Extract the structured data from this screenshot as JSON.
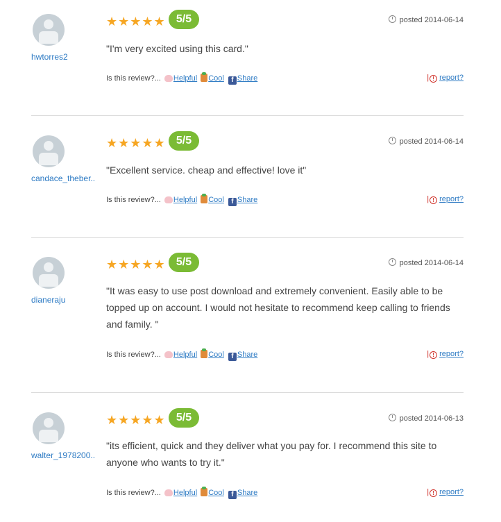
{
  "reviews": [
    {
      "username": "hwtorres2",
      "stars": "★★★★★",
      "score": "5/5",
      "posted": "posted 2014-06-14",
      "text": "\"I'm very excited using this card.\"",
      "prompt": "Is this review?...",
      "helpful": "Helpful",
      "cool": "Cool",
      "share": "Share",
      "report": "report?"
    },
    {
      "username": "candace_theber..",
      "stars": "★★★★★",
      "score": "5/5",
      "posted": "posted 2014-06-14",
      "text": "\"Excellent service. cheap and effective! love it\"",
      "prompt": "Is this review?...",
      "helpful": "Helpful",
      "cool": "Cool",
      "share": "Share",
      "report": "report?"
    },
    {
      "username": "dianeraju",
      "stars": "★★★★★",
      "score": "5/5",
      "posted": "posted 2014-06-14",
      "text": "\"It was easy to use post download and extremely convenient. Easily able to be topped up on account. I would not hesitate to recommend keep calling to friends and family. \"",
      "prompt": "Is this review?...",
      "helpful": "Helpful",
      "cool": "Cool",
      "share": "Share",
      "report": "report?"
    },
    {
      "username": "walter_1978200..",
      "stars": "★★★★★",
      "score": "5/5",
      "posted": "posted 2014-06-13",
      "text": "\"its efficient, quick and they deliver what you pay for. I recommend this site to anyone who wants to try it.\"",
      "prompt": "Is this review?...",
      "helpful": "Helpful",
      "cool": "Cool",
      "share": "Share",
      "report": "report?"
    }
  ],
  "icons": {
    "facebook": "f",
    "warning": "!"
  },
  "colors": {
    "star": "#f6a623",
    "score_badge": "#7bbb35",
    "link": "#2e7bc4",
    "report_warn": "#d0342c"
  }
}
